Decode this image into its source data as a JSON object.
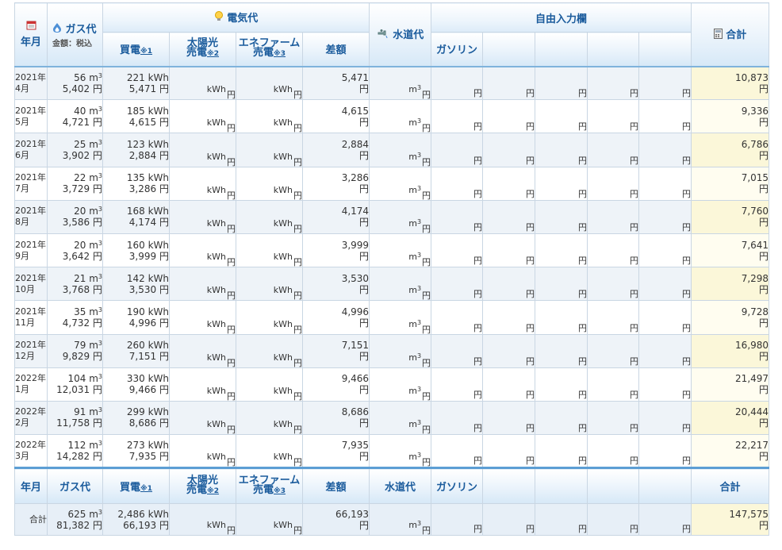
{
  "header": {
    "year_month": "年月",
    "gas": "ガス代",
    "gas_sub": "金額：税込",
    "electricity": "電気代",
    "water": "水道代",
    "free_input": "自由入力欄",
    "total": "合計",
    "buy": "買電",
    "buy_note": "※1",
    "solar_line1": "太陽光",
    "solar_line2": "売電",
    "solar_note": "※2",
    "enefarm_line1": "エネファーム",
    "enefarm_line2": "売電",
    "enefarm_note": "※3",
    "diff": "差額",
    "gasoline": "ガソリン"
  },
  "units": {
    "m3": "m",
    "kwh": "kWh",
    "yen": "円"
  },
  "rows": [
    {
      "y": "2021年",
      "m": "4月",
      "gas_vol": "56",
      "gas_yen": "5,402",
      "kwh": "221",
      "buy_yen": "5,471",
      "diff": "5,471",
      "total": "10,873"
    },
    {
      "y": "2021年",
      "m": "5月",
      "gas_vol": "40",
      "gas_yen": "4,721",
      "kwh": "185",
      "buy_yen": "4,615",
      "diff": "4,615",
      "total": "9,336"
    },
    {
      "y": "2021年",
      "m": "6月",
      "gas_vol": "25",
      "gas_yen": "3,902",
      "kwh": "123",
      "buy_yen": "2,884",
      "diff": "2,884",
      "total": "6,786"
    },
    {
      "y": "2021年",
      "m": "7月",
      "gas_vol": "22",
      "gas_yen": "3,729",
      "kwh": "135",
      "buy_yen": "3,286",
      "diff": "3,286",
      "total": "7,015"
    },
    {
      "y": "2021年",
      "m": "8月",
      "gas_vol": "20",
      "gas_yen": "3,586",
      "kwh": "168",
      "buy_yen": "4,174",
      "diff": "4,174",
      "total": "7,760"
    },
    {
      "y": "2021年",
      "m": "9月",
      "gas_vol": "20",
      "gas_yen": "3,642",
      "kwh": "160",
      "buy_yen": "3,999",
      "diff": "3,999",
      "total": "7,641"
    },
    {
      "y": "2021年",
      "m": "10月",
      "gas_vol": "21",
      "gas_yen": "3,768",
      "kwh": "142",
      "buy_yen": "3,530",
      "diff": "3,530",
      "total": "7,298"
    },
    {
      "y": "2021年",
      "m": "11月",
      "gas_vol": "35",
      "gas_yen": "4,732",
      "kwh": "190",
      "buy_yen": "4,996",
      "diff": "4,996",
      "total": "9,728"
    },
    {
      "y": "2021年",
      "m": "12月",
      "gas_vol": "79",
      "gas_yen": "9,829",
      "kwh": "260",
      "buy_yen": "7,151",
      "diff": "7,151",
      "total": "16,980"
    },
    {
      "y": "2022年",
      "m": "1月",
      "gas_vol": "104",
      "gas_yen": "12,031",
      "kwh": "330",
      "buy_yen": "9,466",
      "diff": "9,466",
      "total": "21,497"
    },
    {
      "y": "2022年",
      "m": "2月",
      "gas_vol": "91",
      "gas_yen": "11,758",
      "kwh": "299",
      "buy_yen": "8,686",
      "diff": "8,686",
      "total": "20,444"
    },
    {
      "y": "2022年",
      "m": "3月",
      "gas_vol": "112",
      "gas_yen": "14,282",
      "kwh": "273",
      "buy_yen": "7,935",
      "diff": "7,935",
      "total": "22,217"
    }
  ],
  "footer": {
    "label": "合計",
    "gas_vol": "625",
    "gas_yen": "81,382",
    "kwh": "2,486",
    "buy_yen": "66,193",
    "diff": "66,193",
    "total": "147,575"
  },
  "colors": {
    "header_text": "#1a5b9c",
    "total_col": "#fbf7d9",
    "row_alt": "#eef3f8"
  },
  "icons": {
    "year_month": "calendar-icon",
    "gas": "gas-flame-icon",
    "electricity": "lightbulb-icon",
    "water": "faucet-icon",
    "total": "calculator-icon"
  }
}
